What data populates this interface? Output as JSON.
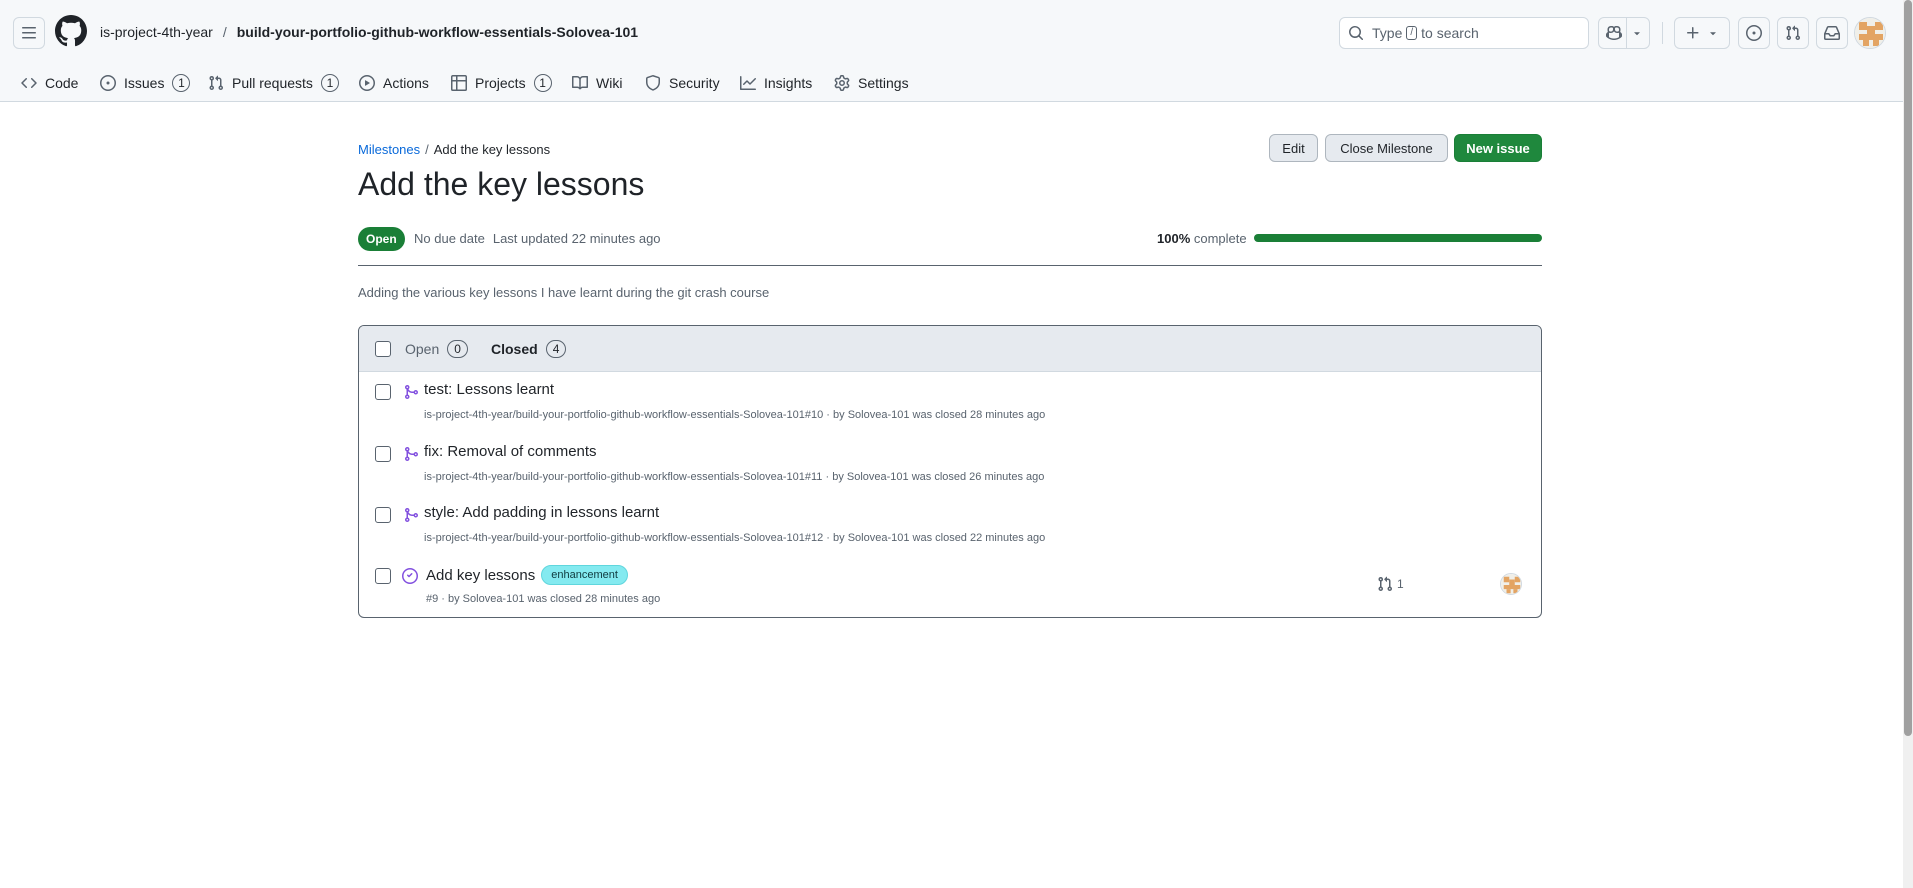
{
  "header": {
    "owner": "is-project-4th-year",
    "separator": "/",
    "repo": "build-your-portfolio-github-workflow-essentials-Solovea-101",
    "search": {
      "prefix": "Type",
      "key": "/",
      "suffix": "to search"
    }
  },
  "nav": {
    "items": [
      {
        "label": "Code",
        "icon": "code-icon"
      },
      {
        "label": "Issues",
        "icon": "issue-icon",
        "count": "1"
      },
      {
        "label": "Pull requests",
        "icon": "pull-request-icon",
        "count": "1"
      },
      {
        "label": "Actions",
        "icon": "play-icon"
      },
      {
        "label": "Projects",
        "icon": "table-icon",
        "count": "1"
      },
      {
        "label": "Wiki",
        "icon": "book-icon"
      },
      {
        "label": "Security",
        "icon": "shield-icon"
      },
      {
        "label": "Insights",
        "icon": "graph-icon"
      },
      {
        "label": "Settings",
        "icon": "gear-icon"
      }
    ]
  },
  "milestone": {
    "breadcrumb_link": "Milestones",
    "breadcrumb_sep": "/",
    "breadcrumb_current": "Add the key lessons",
    "title": "Add the key lessons",
    "status": "Open",
    "due": "No due date",
    "updated": "Last updated 22 minutes ago",
    "progress_pct_label": "100%",
    "progress_word": "complete",
    "progress_fraction": 1.0,
    "description": "Adding the various key lessons I have learnt during the git crash course",
    "buttons": {
      "edit": "Edit",
      "close": "Close Milestone",
      "new_issue": "New issue"
    }
  },
  "list": {
    "open_label": "Open",
    "open_count": "0",
    "closed_label": "Closed",
    "closed_count": "4",
    "rows": [
      {
        "type": "pull-request",
        "title": "test: Lessons learnt",
        "sub": "is-project-4th-year/build-your-portfolio-github-workflow-essentials-Solovea-101#10 · by Solovea-101 was closed 28 minutes ago"
      },
      {
        "type": "pull-request",
        "title": "fix: Removal of comments",
        "sub": "is-project-4th-year/build-your-portfolio-github-workflow-essentials-Solovea-101#11 · by Solovea-101 was closed 26 minutes ago"
      },
      {
        "type": "pull-request",
        "title": "style: Add padding in lessons learnt",
        "sub": "is-project-4th-year/build-your-portfolio-github-workflow-essentials-Solovea-101#12 · by Solovea-101 was closed 22 minutes ago"
      },
      {
        "type": "issue-closed",
        "title": "Add key lessons",
        "label": "enhancement",
        "sub": "#9 · by Solovea-101 was closed 28 minutes ago",
        "linked_prs": "1"
      }
    ]
  },
  "colors": {
    "accent_green": "#1f883d",
    "link_blue": "#0969da",
    "merged_purple": "#8250df",
    "label_enhancement": "#84eaf0"
  }
}
